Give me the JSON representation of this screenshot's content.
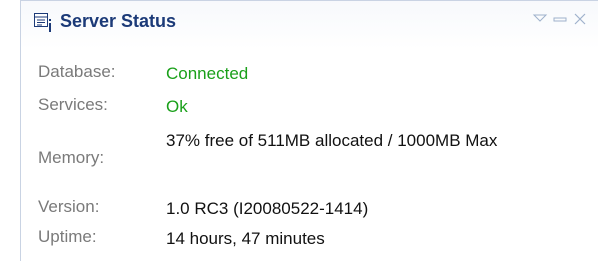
{
  "panel": {
    "title": "Server Status",
    "icons": {
      "title": "server-info-icon",
      "menu": "view-menu-icon",
      "minimize": "minimize-icon",
      "close": "close-icon"
    }
  },
  "status": {
    "database": {
      "label": "Database:",
      "value": "Connected"
    },
    "services": {
      "label": "Services:",
      "value": "Ok"
    },
    "memory": {
      "label": "Memory:",
      "value": "37% free of 511MB allocated / 1000MB Max"
    },
    "version": {
      "label": "Version:",
      "value": "1.0 RC3 (I20080522-1414)"
    },
    "uptime": {
      "label": "Uptime:",
      "value": "14 hours, 47 minutes"
    }
  },
  "colors": {
    "title": "#1c3a78",
    "ok": "#1aa01a",
    "label": "#7a7a7a",
    "border": "#c9d3e3"
  }
}
